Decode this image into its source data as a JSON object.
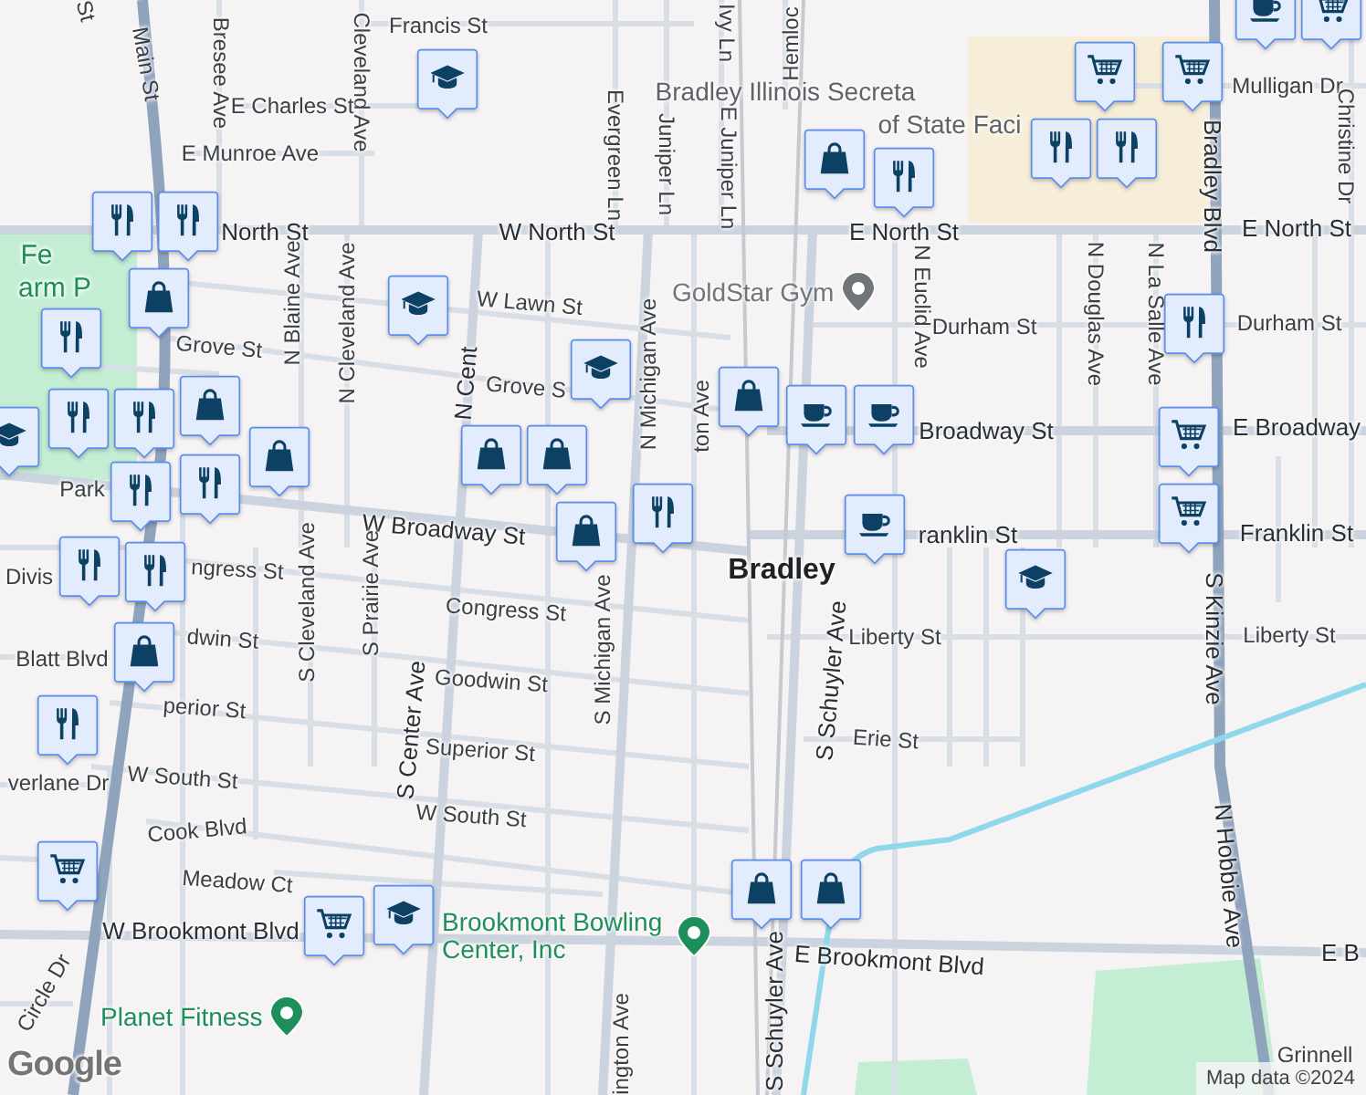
{
  "map": {
    "street_labels": [
      {
        "text": "St",
        "kind": "street"
      },
      {
        "text": "Main St",
        "kind": "street"
      },
      {
        "text": "Bresee Ave",
        "kind": "street"
      },
      {
        "text": "Francis St",
        "kind": "street"
      },
      {
        "text": "Cleveland Ave",
        "kind": "street"
      },
      {
        "text": "E Charles St",
        "kind": "street"
      },
      {
        "text": "E Munroe Ave",
        "kind": "street"
      },
      {
        "text": "Evergreen Ln",
        "kind": "street"
      },
      {
        "text": "Juniper Ln",
        "kind": "street"
      },
      {
        "text": "Ivy Ln",
        "kind": "street"
      },
      {
        "text": "Hemloc",
        "kind": "street"
      },
      {
        "text": "E Juniper Ln",
        "kind": "street"
      },
      {
        "text": "Bradley Illinois Secreta",
        "kind": "building"
      },
      {
        "text": "of State Faci",
        "kind": "building"
      },
      {
        "text": "Mulligan Dr",
        "kind": "street"
      },
      {
        "text": "Christine Dr",
        "kind": "street"
      },
      {
        "text": "North St",
        "kind": "major"
      },
      {
        "text": "W North St",
        "kind": "major"
      },
      {
        "text": "E North St",
        "kind": "major"
      },
      {
        "text": "E North St",
        "kind": "major"
      },
      {
        "text": "Bradley Blvd",
        "kind": "major"
      },
      {
        "text": "N Euclid Ave",
        "kind": "street"
      },
      {
        "text": "N Douglas Ave",
        "kind": "street"
      },
      {
        "text": "N La Salle Ave",
        "kind": "street"
      },
      {
        "text": "Durham St",
        "kind": "street"
      },
      {
        "text": "Durham St",
        "kind": "street"
      },
      {
        "text": "W Lawn St",
        "kind": "street"
      },
      {
        "text": "Grove St",
        "kind": "street"
      },
      {
        "text": "Grove S",
        "kind": "street"
      },
      {
        "text": "N Blaine Ave",
        "kind": "street"
      },
      {
        "text": "N Cleveland Ave",
        "kind": "street"
      },
      {
        "text": "N Cent",
        "kind": "major"
      },
      {
        "text": "N Michigan Ave",
        "kind": "street"
      },
      {
        "text": "ton Ave",
        "kind": "street"
      },
      {
        "text": "Fe",
        "kind": "park"
      },
      {
        "text": "arm P",
        "kind": "park"
      },
      {
        "text": "Broadway St",
        "kind": "major"
      },
      {
        "text": "E Broadway",
        "kind": "major"
      },
      {
        "text": "Park",
        "kind": "street"
      },
      {
        "text": "W Broadway St",
        "kind": "major"
      },
      {
        "text": "ranklin St",
        "kind": "major"
      },
      {
        "text": "Franklin St",
        "kind": "major"
      },
      {
        "text": "Bradley",
        "kind": "city"
      },
      {
        "text": "Divis",
        "kind": "street"
      },
      {
        "text": "ngress St",
        "kind": "street"
      },
      {
        "text": "Congress St",
        "kind": "street"
      },
      {
        "text": "S Cleveland Ave",
        "kind": "street"
      },
      {
        "text": "S Prairie Ave",
        "kind": "street"
      },
      {
        "text": "S Michigan Ave",
        "kind": "street"
      },
      {
        "text": "S Schuyler Ave",
        "kind": "major"
      },
      {
        "text": "Liberty St",
        "kind": "street"
      },
      {
        "text": "Liberty St",
        "kind": "street"
      },
      {
        "text": "dwin St",
        "kind": "street"
      },
      {
        "text": "Goodwin St",
        "kind": "street"
      },
      {
        "text": "Blatt Blvd",
        "kind": "street"
      },
      {
        "text": "perior St",
        "kind": "street"
      },
      {
        "text": "Superior St",
        "kind": "street"
      },
      {
        "text": "Erie St",
        "kind": "street"
      },
      {
        "text": "S Kinzie Ave",
        "kind": "major"
      },
      {
        "text": "S Center Ave",
        "kind": "major"
      },
      {
        "text": "verlane Dr",
        "kind": "street"
      },
      {
        "text": "W South St",
        "kind": "street"
      },
      {
        "text": "W South St",
        "kind": "street"
      },
      {
        "text": "Cook Blvd",
        "kind": "street"
      },
      {
        "text": "Meadow Ct",
        "kind": "street"
      },
      {
        "text": "N Hobbie Ave",
        "kind": "major"
      },
      {
        "text": "W Brookmont Blvd",
        "kind": "major"
      },
      {
        "text": "E Brookmont Blvd",
        "kind": "major"
      },
      {
        "text": "E B",
        "kind": "major"
      },
      {
        "text": "ington Ave",
        "kind": "street"
      },
      {
        "text": "S Schuyler Ave",
        "kind": "major"
      },
      {
        "text": "Circle Dr",
        "kind": "street"
      },
      {
        "text": "Grinnell",
        "kind": "street"
      }
    ],
    "places": [
      {
        "name": "GoldStar Gym",
        "color": "#70757a"
      },
      {
        "name": "Brookmont Bowling Center, Inc",
        "color": "#1e8e5a"
      },
      {
        "name": "Planet Fitness",
        "color": "#1e8e5a"
      }
    ],
    "markers": [
      {
        "kind": "cafe"
      },
      {
        "kind": "grocery"
      },
      {
        "kind": "school"
      },
      {
        "kind": "grocery"
      },
      {
        "kind": "shopping"
      },
      {
        "kind": "restaurant"
      },
      {
        "kind": "restaurant"
      },
      {
        "kind": "grocery"
      },
      {
        "kind": "restaurant"
      },
      {
        "kind": "restaurant"
      },
      {
        "kind": "restaurant"
      },
      {
        "kind": "shopping"
      },
      {
        "kind": "school"
      },
      {
        "kind": "school"
      },
      {
        "kind": "restaurant"
      },
      {
        "kind": "shopping"
      },
      {
        "kind": "cafe"
      },
      {
        "kind": "cafe"
      },
      {
        "kind": "restaurant"
      },
      {
        "kind": "grocery"
      },
      {
        "kind": "grocery"
      },
      {
        "kind": "shopping"
      },
      {
        "kind": "restaurant"
      },
      {
        "kind": "restaurant"
      },
      {
        "kind": "restaurant"
      },
      {
        "kind": "shopping"
      },
      {
        "kind": "restaurant"
      },
      {
        "kind": "shopping"
      },
      {
        "kind": "shopping"
      },
      {
        "kind": "shopping"
      },
      {
        "kind": "restaurant"
      },
      {
        "kind": "school"
      },
      {
        "kind": "restaurant"
      },
      {
        "kind": "restaurant"
      },
      {
        "kind": "shopping"
      },
      {
        "kind": "restaurant"
      },
      {
        "kind": "cafe"
      },
      {
        "kind": "school"
      },
      {
        "kind": "grocery"
      },
      {
        "kind": "grocery"
      },
      {
        "kind": "school"
      },
      {
        "kind": "shopping"
      },
      {
        "kind": "shopping"
      }
    ],
    "attribution": {
      "logo": "Google",
      "text": "Map data ©2024"
    }
  }
}
